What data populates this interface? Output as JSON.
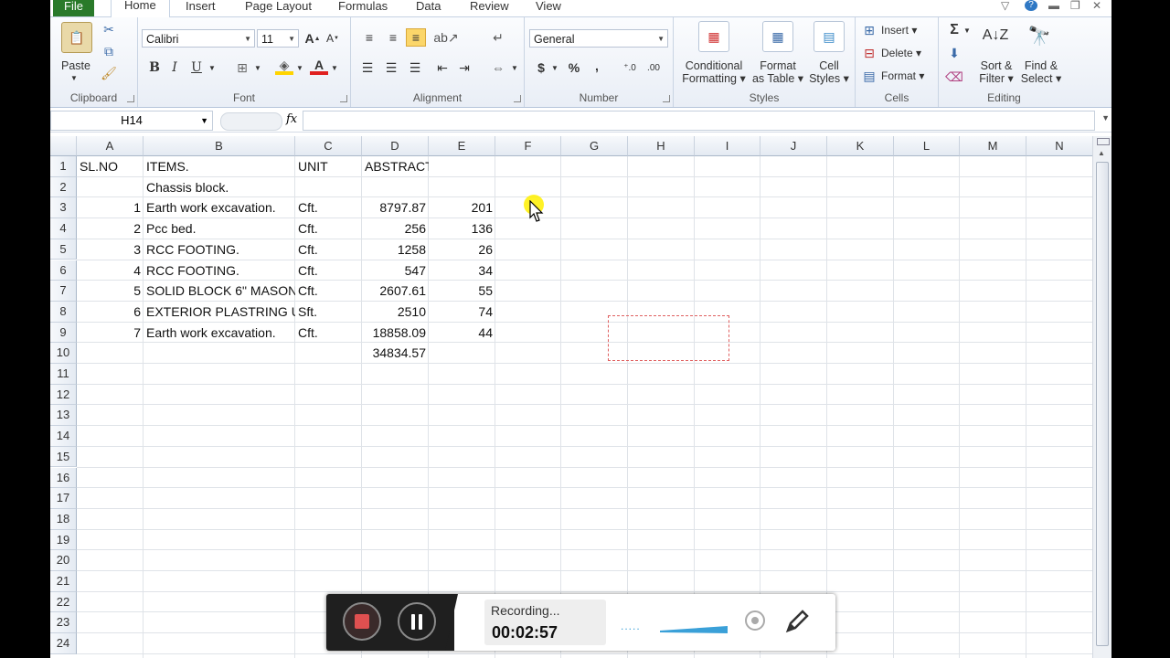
{
  "ribbon": {
    "tabs": [
      "File",
      "Home",
      "Insert",
      "Page Layout",
      "Formulas",
      "Data",
      "Review",
      "View"
    ],
    "clipboard": {
      "paste": "Paste",
      "label": "Clipboard"
    },
    "font": {
      "name": "Calibri",
      "size": "11",
      "bold": "B",
      "italic": "I",
      "underline": "U",
      "label": "Font"
    },
    "alignment": {
      "label": "Alignment"
    },
    "number": {
      "format": "General",
      "currency": "$",
      "percent": "%",
      "comma": ",",
      "label": "Number"
    },
    "styles": {
      "conditional": "Conditional",
      "conditional2": "Formatting",
      "format_table": "Format",
      "format_table2": "as Table",
      "cell_styles": "Cell",
      "cell_styles2": "Styles",
      "label": "Styles"
    },
    "cells": {
      "insert": "Insert",
      "delete": "Delete",
      "format": "Format",
      "label": "Cells"
    },
    "editing": {
      "sigma": "Σ",
      "sort": "Sort &",
      "sort2": "Filter",
      "find": "Find &",
      "find2": "Select",
      "label": "Editing"
    }
  },
  "formula_bar": {
    "name_box": "H14",
    "fx": "fx",
    "value": ""
  },
  "columns": [
    "A",
    "B",
    "C",
    "D",
    "E",
    "F",
    "G",
    "H",
    "I",
    "J",
    "K",
    "L",
    "M",
    "N"
  ],
  "rows": [
    "1",
    "2",
    "3",
    "4",
    "5",
    "6",
    "7",
    "8",
    "9",
    "10",
    "11",
    "12",
    "13",
    "14",
    "15",
    "16",
    "17",
    "18",
    "19",
    "20",
    "21",
    "22",
    "23",
    "24"
  ],
  "cells": {
    "A1": "SL.NO",
    "B1": "ITEMS.",
    "C1": "UNIT",
    "D1": "ABSTRACT.",
    "B2": "Chassis block.",
    "A3": "1",
    "B3": "Earth work excavation.",
    "C3": "Cft.",
    "D3": "8797.87",
    "E3": "201",
    "A4": "2",
    "B4": "Pcc bed.",
    "C4": "Cft.",
    "D4": "256",
    "E4": "136",
    "A5": "3",
    "B5": "RCC FOOTING.",
    "C5": "Cft.",
    "D5": "1258",
    "E5": "26",
    "A6": "4",
    "B6": "RCC FOOTING.",
    "C6": "Cft.",
    "D6": "547",
    "E6": "34",
    "A7": "5",
    "B7": "SOLID BLOCK 6\" MASON",
    "C7": "Cft.",
    "D7": "2607.61",
    "E7": "55",
    "A8": "6",
    "B8": "EXTERIOR PLASTRING U",
    "C8": "Sft.",
    "D8": "2510",
    "E8": "74",
    "A9": "7",
    "B9": "Earth work excavation.",
    "C9": "Cft.",
    "D9": "18858.09",
    "E9": "44",
    "D10": "34834.57"
  },
  "recorder": {
    "status": "Recording...",
    "time": "00:02:57",
    "dots": "....."
  },
  "colors": {
    "file_tab": "#2a7a2a",
    "stop": "#e05050",
    "accent": "#3aa0d8"
  }
}
